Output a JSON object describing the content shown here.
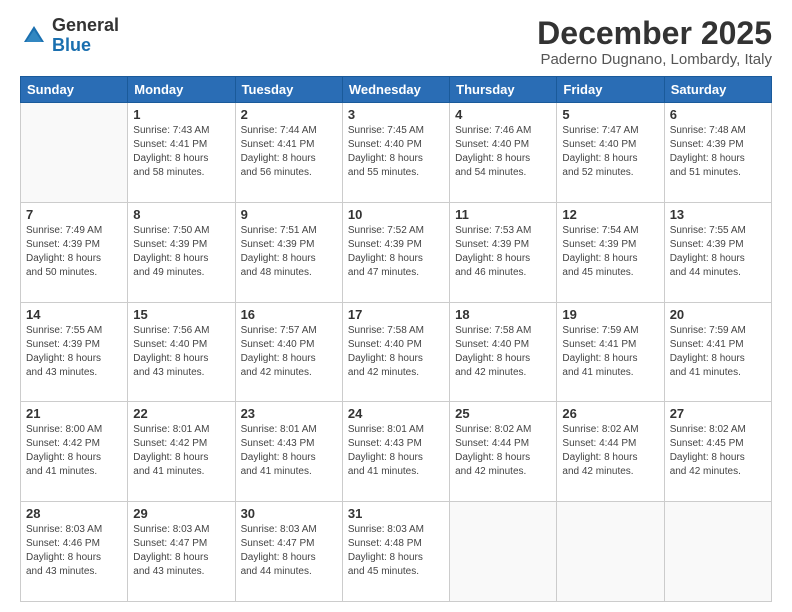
{
  "logo": {
    "general": "General",
    "blue": "Blue"
  },
  "title": "December 2025",
  "subtitle": "Paderno Dugnano, Lombardy, Italy",
  "days_header": [
    "Sunday",
    "Monday",
    "Tuesday",
    "Wednesday",
    "Thursday",
    "Friday",
    "Saturday"
  ],
  "weeks": [
    [
      {
        "day": "",
        "info": ""
      },
      {
        "day": "1",
        "info": "Sunrise: 7:43 AM\nSunset: 4:41 PM\nDaylight: 8 hours\nand 58 minutes."
      },
      {
        "day": "2",
        "info": "Sunrise: 7:44 AM\nSunset: 4:41 PM\nDaylight: 8 hours\nand 56 minutes."
      },
      {
        "day": "3",
        "info": "Sunrise: 7:45 AM\nSunset: 4:40 PM\nDaylight: 8 hours\nand 55 minutes."
      },
      {
        "day": "4",
        "info": "Sunrise: 7:46 AM\nSunset: 4:40 PM\nDaylight: 8 hours\nand 54 minutes."
      },
      {
        "day": "5",
        "info": "Sunrise: 7:47 AM\nSunset: 4:40 PM\nDaylight: 8 hours\nand 52 minutes."
      },
      {
        "day": "6",
        "info": "Sunrise: 7:48 AM\nSunset: 4:39 PM\nDaylight: 8 hours\nand 51 minutes."
      }
    ],
    [
      {
        "day": "7",
        "info": "Sunrise: 7:49 AM\nSunset: 4:39 PM\nDaylight: 8 hours\nand 50 minutes."
      },
      {
        "day": "8",
        "info": "Sunrise: 7:50 AM\nSunset: 4:39 PM\nDaylight: 8 hours\nand 49 minutes."
      },
      {
        "day": "9",
        "info": "Sunrise: 7:51 AM\nSunset: 4:39 PM\nDaylight: 8 hours\nand 48 minutes."
      },
      {
        "day": "10",
        "info": "Sunrise: 7:52 AM\nSunset: 4:39 PM\nDaylight: 8 hours\nand 47 minutes."
      },
      {
        "day": "11",
        "info": "Sunrise: 7:53 AM\nSunset: 4:39 PM\nDaylight: 8 hours\nand 46 minutes."
      },
      {
        "day": "12",
        "info": "Sunrise: 7:54 AM\nSunset: 4:39 PM\nDaylight: 8 hours\nand 45 minutes."
      },
      {
        "day": "13",
        "info": "Sunrise: 7:55 AM\nSunset: 4:39 PM\nDaylight: 8 hours\nand 44 minutes."
      }
    ],
    [
      {
        "day": "14",
        "info": "Sunrise: 7:55 AM\nSunset: 4:39 PM\nDaylight: 8 hours\nand 43 minutes."
      },
      {
        "day": "15",
        "info": "Sunrise: 7:56 AM\nSunset: 4:40 PM\nDaylight: 8 hours\nand 43 minutes."
      },
      {
        "day": "16",
        "info": "Sunrise: 7:57 AM\nSunset: 4:40 PM\nDaylight: 8 hours\nand 42 minutes."
      },
      {
        "day": "17",
        "info": "Sunrise: 7:58 AM\nSunset: 4:40 PM\nDaylight: 8 hours\nand 42 minutes."
      },
      {
        "day": "18",
        "info": "Sunrise: 7:58 AM\nSunset: 4:40 PM\nDaylight: 8 hours\nand 42 minutes."
      },
      {
        "day": "19",
        "info": "Sunrise: 7:59 AM\nSunset: 4:41 PM\nDaylight: 8 hours\nand 41 minutes."
      },
      {
        "day": "20",
        "info": "Sunrise: 7:59 AM\nSunset: 4:41 PM\nDaylight: 8 hours\nand 41 minutes."
      }
    ],
    [
      {
        "day": "21",
        "info": "Sunrise: 8:00 AM\nSunset: 4:42 PM\nDaylight: 8 hours\nand 41 minutes."
      },
      {
        "day": "22",
        "info": "Sunrise: 8:01 AM\nSunset: 4:42 PM\nDaylight: 8 hours\nand 41 minutes."
      },
      {
        "day": "23",
        "info": "Sunrise: 8:01 AM\nSunset: 4:43 PM\nDaylight: 8 hours\nand 41 minutes."
      },
      {
        "day": "24",
        "info": "Sunrise: 8:01 AM\nSunset: 4:43 PM\nDaylight: 8 hours\nand 41 minutes."
      },
      {
        "day": "25",
        "info": "Sunrise: 8:02 AM\nSunset: 4:44 PM\nDaylight: 8 hours\nand 42 minutes."
      },
      {
        "day": "26",
        "info": "Sunrise: 8:02 AM\nSunset: 4:44 PM\nDaylight: 8 hours\nand 42 minutes."
      },
      {
        "day": "27",
        "info": "Sunrise: 8:02 AM\nSunset: 4:45 PM\nDaylight: 8 hours\nand 42 minutes."
      }
    ],
    [
      {
        "day": "28",
        "info": "Sunrise: 8:03 AM\nSunset: 4:46 PM\nDaylight: 8 hours\nand 43 minutes."
      },
      {
        "day": "29",
        "info": "Sunrise: 8:03 AM\nSunset: 4:47 PM\nDaylight: 8 hours\nand 43 minutes."
      },
      {
        "day": "30",
        "info": "Sunrise: 8:03 AM\nSunset: 4:47 PM\nDaylight: 8 hours\nand 44 minutes."
      },
      {
        "day": "31",
        "info": "Sunrise: 8:03 AM\nSunset: 4:48 PM\nDaylight: 8 hours\nand 45 minutes."
      },
      {
        "day": "",
        "info": ""
      },
      {
        "day": "",
        "info": ""
      },
      {
        "day": "",
        "info": ""
      }
    ]
  ]
}
